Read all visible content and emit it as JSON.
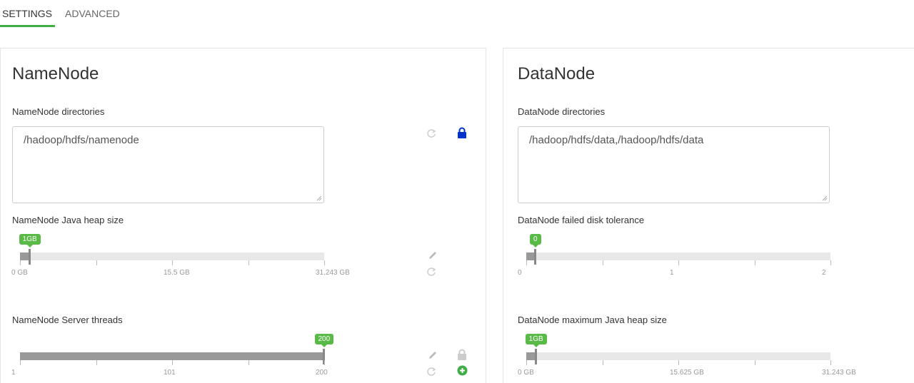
{
  "tabs": [
    {
      "label": "SETTINGS",
      "active": true
    },
    {
      "label": "ADVANCED",
      "active": false
    }
  ],
  "colors": {
    "accent": "#3fae49",
    "bubble": "#5aba47",
    "lock_blue": "#0033cc"
  },
  "namenode": {
    "title": "NameNode",
    "directories": {
      "label": "NameNode directories",
      "value": "/hadoop/hdfs/namenode"
    },
    "heap": {
      "label": "NameNode Java heap size",
      "value_label": "1GB",
      "value": 1,
      "min": 0,
      "max": 31.243,
      "ticks": [
        "0 GB",
        "15.5 GB",
        "31.243 GB"
      ]
    },
    "threads": {
      "label": "NameNode Server threads",
      "value_label": "200",
      "value": 200,
      "min": 1,
      "max": 200,
      "ticks": [
        "1",
        "101",
        "200"
      ]
    }
  },
  "datanode": {
    "title": "DataNode",
    "directories": {
      "label": "DataNode directories",
      "value": "/hadoop/hdfs/data,/hadoop/hdfs/data"
    },
    "tolerance": {
      "label": "DataNode failed disk tolerance",
      "value_label": "0",
      "value": 0,
      "min": 0,
      "max": 2,
      "ticks": [
        "0",
        "1",
        "2"
      ]
    },
    "heap": {
      "label": "DataNode maximum Java heap size",
      "value_label": "1GB",
      "value": 1,
      "min": 0,
      "max": 31.243,
      "ticks": [
        "0 GB",
        "15.625 GB",
        "31.243 GB"
      ]
    }
  }
}
